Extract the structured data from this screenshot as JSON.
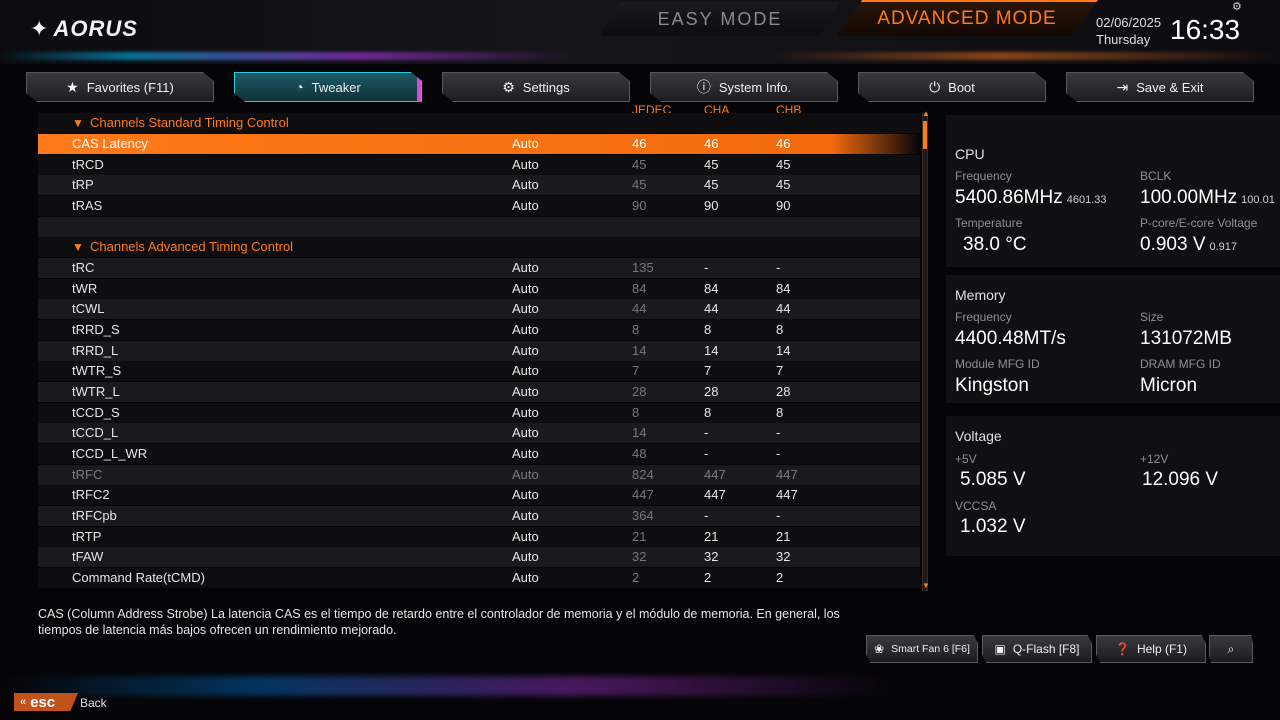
{
  "header": {
    "brand": "AORUS",
    "easy_mode": "EASY MODE",
    "advanced_mode": "ADVANCED MODE",
    "date": "02/06/2025",
    "weekday": "Thursday",
    "time": "16:33"
  },
  "tabs": [
    {
      "label": "Favorites (F11)",
      "icon": "star-icon"
    },
    {
      "label": "Tweaker",
      "icon": "gauge-icon"
    },
    {
      "label": "Settings",
      "icon": "gear-icon"
    },
    {
      "label": "System Info.",
      "icon": "info-icon"
    },
    {
      "label": "Boot",
      "icon": "power-icon"
    },
    {
      "label": "Save & Exit",
      "icon": "exit-icon"
    }
  ],
  "columns": {
    "jedec": "JEDEC",
    "cha": "CHA",
    "chb": "CHB"
  },
  "sections": {
    "standard": "Channels Standard Timing Control",
    "advanced": "Channels Advanced Timing Control"
  },
  "rows": [
    {
      "name": "CAS Latency",
      "value": "Auto",
      "jedec": "46",
      "cha": "46",
      "chb": "46"
    },
    {
      "name": "tRCD",
      "value": "Auto",
      "jedec": "45",
      "cha": "45",
      "chb": "45"
    },
    {
      "name": "tRP",
      "value": "Auto",
      "jedec": "45",
      "cha": "45",
      "chb": "45"
    },
    {
      "name": "tRAS",
      "value": "Auto",
      "jedec": "90",
      "cha": "90",
      "chb": "90"
    },
    {
      "name": "tRC",
      "value": "Auto",
      "jedec": "135",
      "cha": "-",
      "chb": "-"
    },
    {
      "name": "tWR",
      "value": "Auto",
      "jedec": "84",
      "cha": "84",
      "chb": "84"
    },
    {
      "name": "tCWL",
      "value": "Auto",
      "jedec": "44",
      "cha": "44",
      "chb": "44"
    },
    {
      "name": "tRRD_S",
      "value": "Auto",
      "jedec": "8",
      "cha": "8",
      "chb": "8"
    },
    {
      "name": "tRRD_L",
      "value": "Auto",
      "jedec": "14",
      "cha": "14",
      "chb": "14"
    },
    {
      "name": "tWTR_S",
      "value": "Auto",
      "jedec": "7",
      "cha": "7",
      "chb": "7"
    },
    {
      "name": "tWTR_L",
      "value": "Auto",
      "jedec": "28",
      "cha": "28",
      "chb": "28"
    },
    {
      "name": "tCCD_S",
      "value": "Auto",
      "jedec": "8",
      "cha": "8",
      "chb": "8"
    },
    {
      "name": "tCCD_L",
      "value": "Auto",
      "jedec": "14",
      "cha": "-",
      "chb": "-"
    },
    {
      "name": "tCCD_L_WR",
      "value": "Auto",
      "jedec": "48",
      "cha": "-",
      "chb": "-"
    },
    {
      "name": "tRFC",
      "value": "Auto",
      "jedec": "824",
      "cha": "447",
      "chb": "447"
    },
    {
      "name": "tRFC2",
      "value": "Auto",
      "jedec": "447",
      "cha": "447",
      "chb": "447"
    },
    {
      "name": "tRFCpb",
      "value": "Auto",
      "jedec": "364",
      "cha": "-",
      "chb": "-"
    },
    {
      "name": "tRTP",
      "value": "Auto",
      "jedec": "21",
      "cha": "21",
      "chb": "21"
    },
    {
      "name": "tFAW",
      "value": "Auto",
      "jedec": "32",
      "cha": "32",
      "chb": "32"
    },
    {
      "name": "Command Rate(tCMD)",
      "value": "Auto",
      "jedec": "2",
      "cha": "2",
      "chb": "2"
    }
  ],
  "info": {
    "cpu": {
      "title": "CPU",
      "freq_label": "Frequency",
      "freq": "5400.86MHz",
      "freq_sub": "4601.33",
      "bclk_label": "BCLK",
      "bclk": "100.00MHz",
      "bclk_sub": "100.01",
      "temp_label": "Temperature",
      "temp": "38.0 °C",
      "volt_label": "P-core/E-core Voltage",
      "volt": "0.903 V",
      "volt_sub": "0.917"
    },
    "memory": {
      "title": "Memory",
      "freq_label": "Frequency",
      "freq": "4400.48MT/s",
      "size_label": "Size",
      "size": "131072MB",
      "module_label": "Module MFG ID",
      "module": "Kingston",
      "dram_label": "DRAM MFG ID",
      "dram": "Micron"
    },
    "voltage": {
      "title": "Voltage",
      "v5_label": "+5V",
      "v5": "5.085 V",
      "v12_label": "+12V",
      "v12": "12.096 V",
      "vccsa_label": "VCCSA",
      "vccsa": "1.032 V"
    }
  },
  "description": "CAS (Column Address Strobe) La latencia CAS es el tiempo de retardo entre el controlador de memoria y el módulo de memoria. En general, los tiempos de latencia más bajos ofrecen un rendimiento mejorado.",
  "bottom": {
    "smartfan": "Smart Fan 6 [F6]",
    "qflash": "Q-Flash [F8]",
    "help": "Help (F1)",
    "esc": "esc",
    "back": "Back"
  },
  "colors": {
    "accent": "#ff7a1a",
    "active_tab": "#1d5a66",
    "background": "#050507"
  }
}
